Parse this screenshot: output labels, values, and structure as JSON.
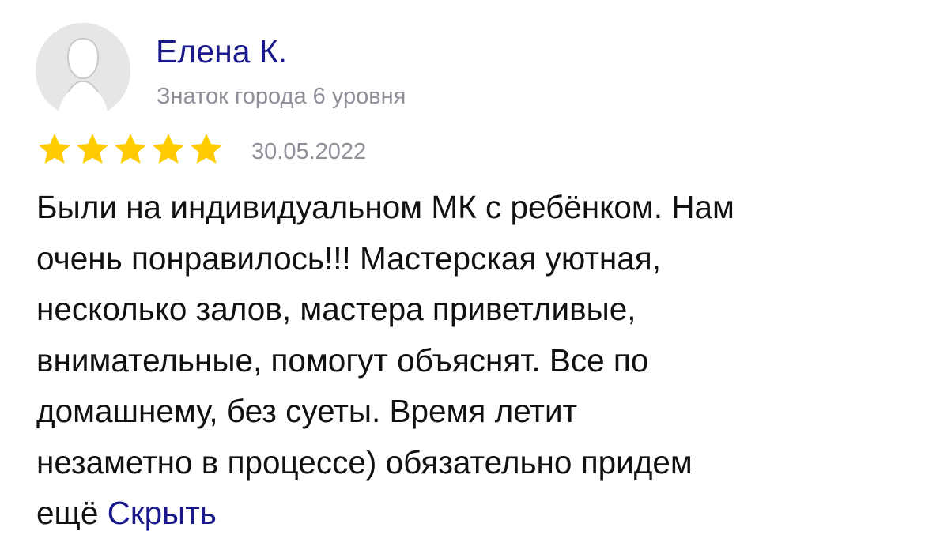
{
  "author": {
    "name": "Елена К.",
    "level": "Знаток города 6 уровня",
    "avatar_icon": "user-silhouette-icon"
  },
  "rating": {
    "value": 5,
    "max": 5,
    "star_color": "#ffcc00",
    "star_icon": "star-icon"
  },
  "date": "30.05.2022",
  "review": {
    "text_lines": [
      "Были на индивидуальном МК с ребёнком. Нам",
      "очень понравилось!!! Мастерская уютная,",
      "несколько залов, мастера приветливые,",
      "внимательные, помогут объяснят. Все по",
      "домашнему, без суеты. Время летит",
      "незаметно в процессе) обязательно придем",
      "ещё"
    ],
    "hide_label": "Скрыть"
  },
  "colors": {
    "link": "#1a1a8c",
    "secondary_text": "#8f8f99",
    "text": "#111111"
  }
}
